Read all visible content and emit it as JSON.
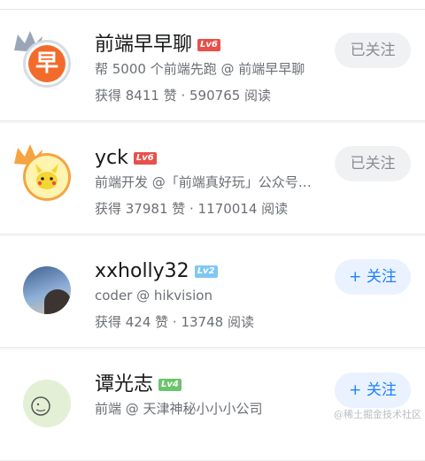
{
  "colors": {
    "lv6": "#e8504b",
    "lv2": "#7fc7f0",
    "lv4": "#6cc46c",
    "accent": "#1e80ff"
  },
  "users": [
    {
      "name": "前端早早聊",
      "level": "Lv6",
      "bio": "帮 5000 个前端先跑 @ 前端早早聊",
      "stats": "获得 8411 赞 · 590765 阅读",
      "button": "已关注",
      "followed": true,
      "avatar_text": "早"
    },
    {
      "name": "yck",
      "level": "Lv6",
      "bio": "前端开发 @「前端真好玩」公众号…",
      "stats": "获得 37981 赞 · 1170014 阅读",
      "button": "已关注",
      "followed": true
    },
    {
      "name": "xxholly32",
      "level": "Lv2",
      "bio": "coder @ hikvision",
      "stats": "获得 424 赞 · 13748 阅读",
      "button": "+ 关注",
      "followed": false
    },
    {
      "name": "谭光志",
      "level": "Lv4",
      "bio": "前端 @ 天津神秘小小小公司",
      "stats": "",
      "button": "+ 关注",
      "followed": false
    }
  ],
  "watermark": "@稀土掘金技术社区"
}
